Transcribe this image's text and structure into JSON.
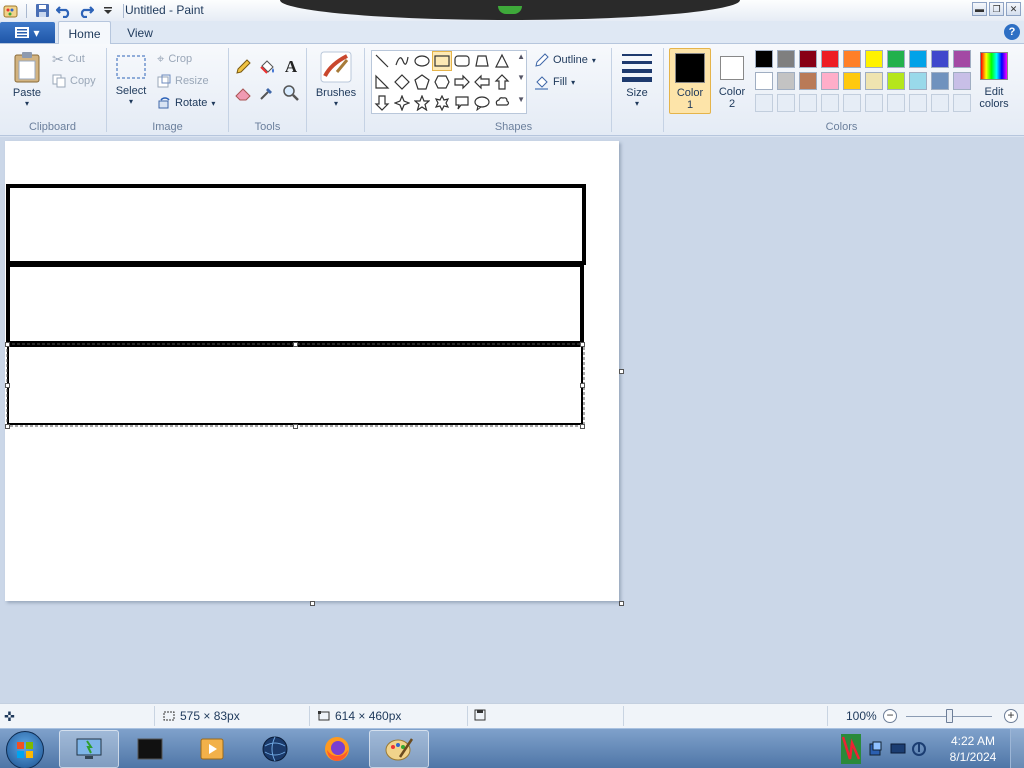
{
  "window": {
    "title": "Untitled - Paint"
  },
  "tabs": [
    {
      "label": "Home"
    },
    {
      "label": "View"
    }
  ],
  "ribbon": {
    "clipboard": {
      "label": "Clipboard",
      "paste": "Paste",
      "cut": "Cut",
      "copy": "Copy"
    },
    "image": {
      "label": "Image",
      "select": "Select",
      "crop": "Crop",
      "resize": "Resize",
      "rotate": "Rotate"
    },
    "tools": {
      "label": "Tools"
    },
    "brushes": {
      "label": "Brushes"
    },
    "shapes": {
      "label": "Shapes",
      "outline": "Outline",
      "fill": "Fill"
    },
    "size": {
      "label": "Size"
    },
    "colors": {
      "label": "Colors",
      "color1_line1": "Color",
      "color1_line2": "1",
      "color2_line1": "Color",
      "color2_line2": "2",
      "edit_line1": "Edit",
      "edit_line2": "colors",
      "color1_value": "#000000",
      "color2_value": "#ffffff",
      "palette_row1": [
        "#000000",
        "#7f7f7f",
        "#880015",
        "#ed1c24",
        "#ff7f27",
        "#fff200",
        "#22b14c",
        "#00a2e8",
        "#3f48cc",
        "#a349a4"
      ],
      "palette_row2": [
        "#ffffff",
        "#c3c3c3",
        "#b97a57",
        "#ffaec9",
        "#ffc90e",
        "#efe4b0",
        "#b5e61d",
        "#99d9ea",
        "#7092be",
        "#c8bfe7"
      ]
    }
  },
  "status": {
    "selection_size": "575 × 83px",
    "canvas_size": "614 × 460px",
    "zoom": "100%"
  },
  "taskbar": {
    "time": "4:22 AM",
    "date": "8/1/2024"
  }
}
